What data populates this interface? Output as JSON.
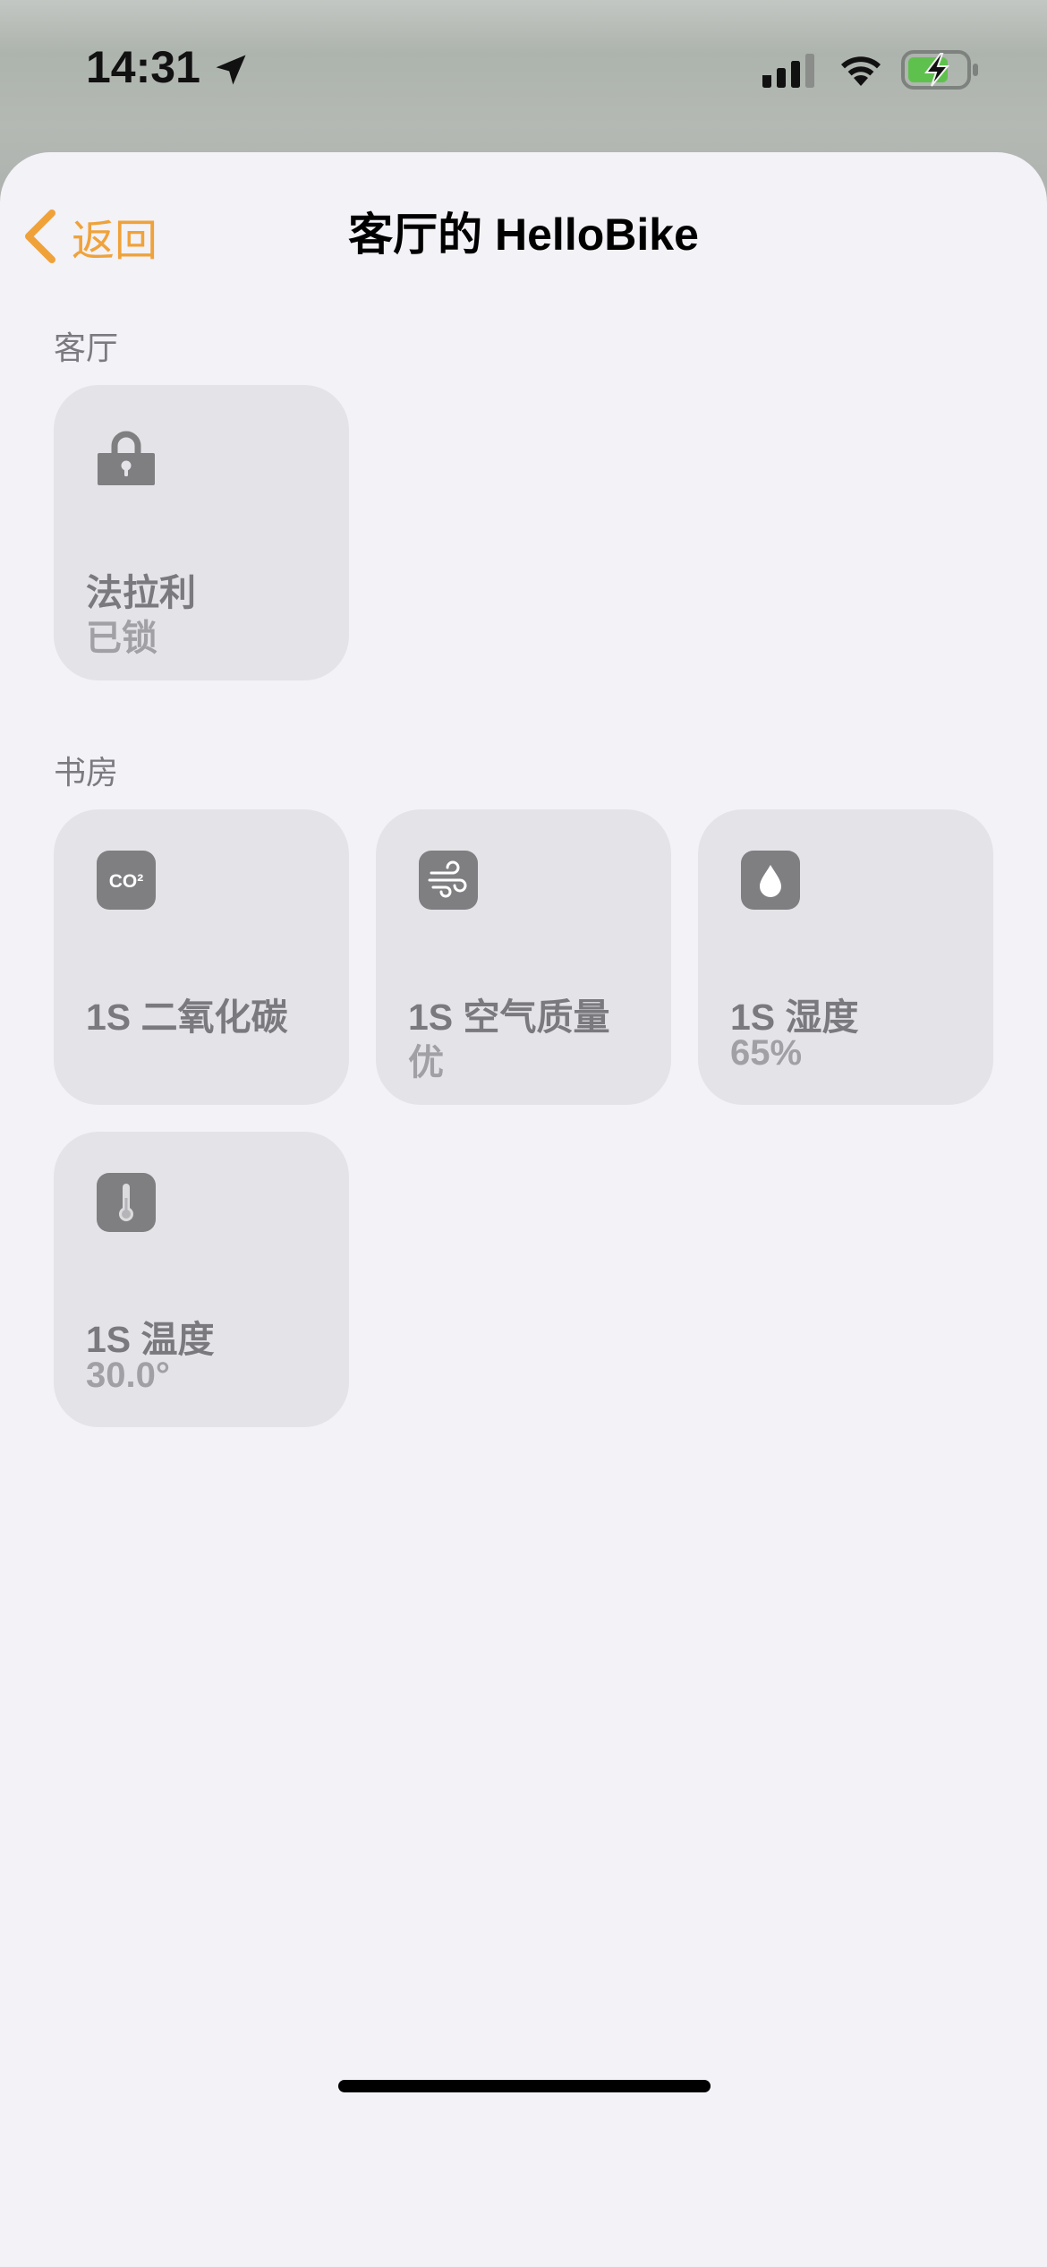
{
  "status_bar": {
    "time": "14:31",
    "icons": [
      "location-arrow-icon",
      "cellular-signal-icon",
      "wifi-icon",
      "battery-charging-icon"
    ]
  },
  "nav": {
    "back_label": "返回",
    "title": "客厅的 HelloBike"
  },
  "sections": [
    {
      "header": "客厅",
      "tiles": [
        {
          "icon": "lock-icon",
          "name": "法拉利",
          "status": "已锁"
        }
      ]
    },
    {
      "header": "书房",
      "tiles": [
        {
          "icon": "co2-icon",
          "name": "1S 二氧化碳",
          "status": ""
        },
        {
          "icon": "air-quality-icon",
          "name": "1S 空气质量",
          "status": "优"
        },
        {
          "icon": "humidity-icon",
          "name": "1S 湿度",
          "status": "65%"
        },
        {
          "icon": "thermometer-icon",
          "name": "1S 温度",
          "status": "30.0°"
        }
      ]
    }
  ],
  "colors": {
    "accent": "#f0a23a",
    "sheet_background": "#f2f2f7",
    "tile_background": "#e4e4e8",
    "icon_badge": "#7f7f82"
  },
  "co2_icon_text": "CO²"
}
